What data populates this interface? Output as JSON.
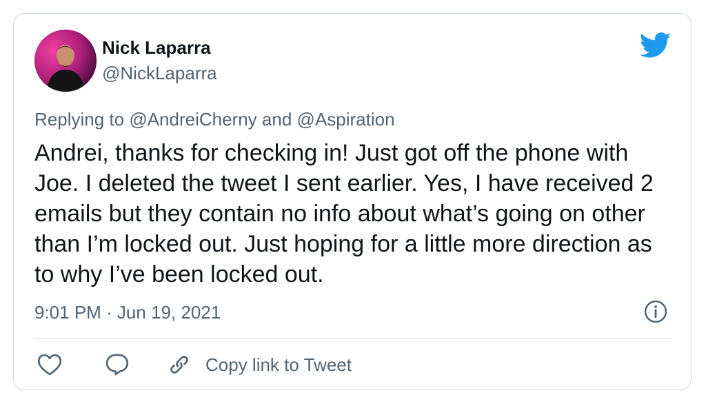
{
  "author": {
    "display_name": "Nick Laparra",
    "handle": "@NickLaparra"
  },
  "replying": {
    "prefix": "Replying to",
    "mention_1": "@AndreiCherny",
    "joiner": "and",
    "mention_2": "@Aspiration"
  },
  "tweet": {
    "text": "Andrei, thanks for checking in! Just got off the phone with Joe. I deleted the tweet I sent earlier. Yes, I have received 2 emails but they contain no info about what’s going on other than I’m locked out. Just hoping for a little more direction as to why I’ve been locked out.",
    "timestamp": "9:01 PM · Jun 19, 2021"
  },
  "actions": {
    "copy_link_label": "Copy link to Tweet"
  },
  "icons": {
    "brand": "twitter-bird-icon",
    "info": "info-icon",
    "like": "heart-icon",
    "reply": "speech-bubble-icon",
    "copy": "link-icon"
  },
  "colors": {
    "brand": "#1d9bf0",
    "text": "#0f1419",
    "secondary": "#536471",
    "border": "#cfd9de"
  }
}
